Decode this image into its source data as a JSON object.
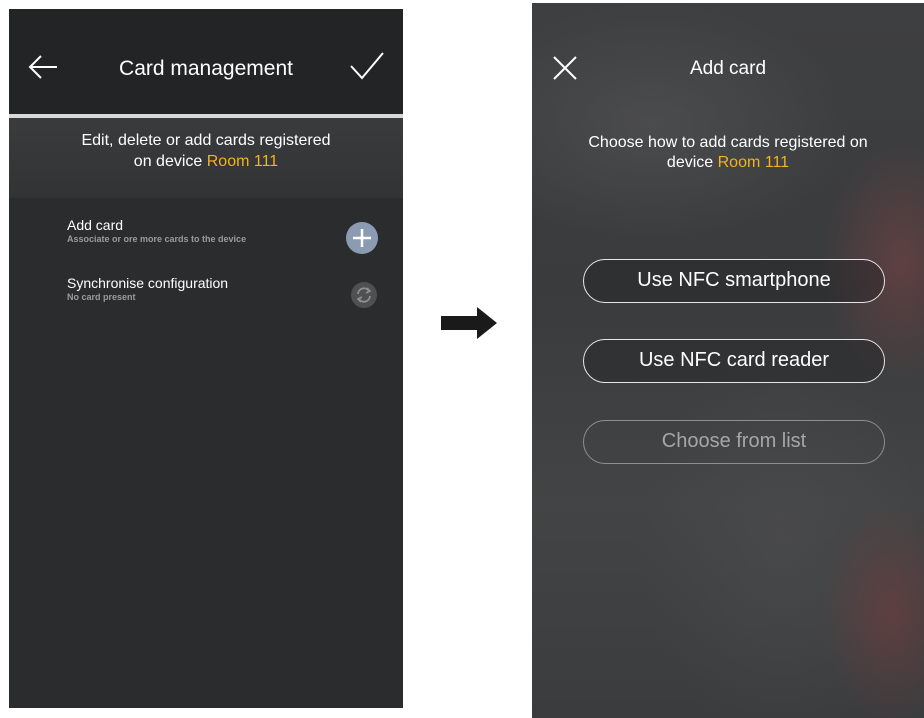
{
  "left_screen": {
    "header": {
      "title": "Card management",
      "back_icon": "arrow-left-icon",
      "confirm_icon": "check-icon"
    },
    "intro": {
      "line1": "Edit, delete or add cards registered",
      "line2_prefix": "on device",
      "device_name": "Room 111"
    },
    "items": [
      {
        "title": "Add card",
        "subtitle": "Associate or ore more cards to the device",
        "icon": "plus-icon"
      },
      {
        "title": "Synchronise configuration",
        "subtitle": "No card present",
        "icon": "sync-icon"
      }
    ]
  },
  "transition_icon": "right-arrow-icon",
  "right_screen": {
    "header": {
      "title": "Add card",
      "close_icon": "close-icon"
    },
    "intro": {
      "line1": "Choose how to add cards registered on",
      "line2_prefix": "device",
      "device_name": "Room 111"
    },
    "options": [
      {
        "label": "Use NFC smartphone",
        "enabled": true
      },
      {
        "label": "Use NFC card reader",
        "enabled": true
      },
      {
        "label": "Choose from list",
        "enabled": false
      }
    ]
  },
  "colors": {
    "accent": "#f2b31b",
    "screen_bg": "#2b2c2e",
    "add_button": "#8a9bb2"
  }
}
